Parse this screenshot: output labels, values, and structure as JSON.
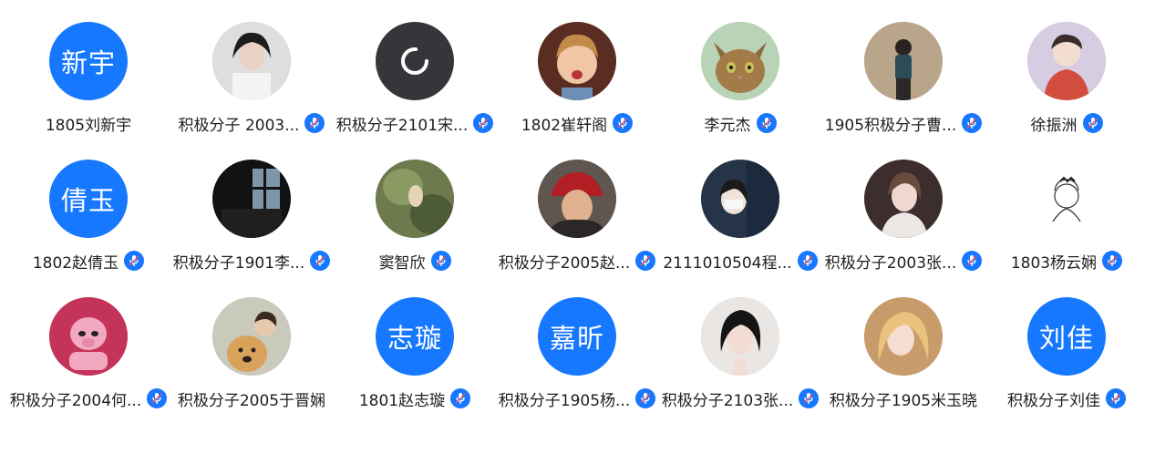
{
  "colors": {
    "accent": "#1677ff",
    "text": "#1e1e1e",
    "background": "#ffffff"
  },
  "mic_icon": "microphone-icon",
  "members": [
    {
      "name": "1805刘新宇",
      "avatar_text": "新宇",
      "avatar_type": "text",
      "mic": false
    },
    {
      "name": "积极分子 2003...",
      "avatar_type": "photo",
      "photo_desc_icon": "person-photo",
      "mic": true
    },
    {
      "name": "积极分子2101宋...",
      "avatar_type": "loading",
      "mic": true
    },
    {
      "name": "1802崔轩阁",
      "avatar_type": "photo",
      "photo_desc_icon": "child-photo",
      "mic": true
    },
    {
      "name": "李元杰",
      "avatar_type": "photo",
      "photo_desc_icon": "cat-photo",
      "mic": true
    },
    {
      "name": "1905积极分子曹...",
      "avatar_type": "photo",
      "photo_desc_icon": "person-photo",
      "mic": true
    },
    {
      "name": "徐振洲",
      "avatar_type": "photo",
      "photo_desc_icon": "illustration-photo",
      "mic": true
    },
    {
      "name": "1802赵倩玉",
      "avatar_text": "倩玉",
      "avatar_type": "text",
      "mic": true
    },
    {
      "name": "积极分子1901李...",
      "avatar_type": "photo",
      "photo_desc_icon": "window-photo",
      "mic": true
    },
    {
      "name": "窦智欣",
      "avatar_type": "photo",
      "photo_desc_icon": "person-photo",
      "mic": true
    },
    {
      "name": "积极分子2005赵...",
      "avatar_type": "photo",
      "photo_desc_icon": "person-hat-photo",
      "mic": true
    },
    {
      "name": "2111010504程...",
      "avatar_type": "photo",
      "photo_desc_icon": "person-photo",
      "mic": true
    },
    {
      "name": "积极分子2003张...",
      "avatar_type": "photo",
      "photo_desc_icon": "person-photo",
      "mic": true
    },
    {
      "name": "1803杨云娴",
      "avatar_type": "photo",
      "photo_desc_icon": "sketch-photo",
      "mic": true
    },
    {
      "name": "积极分子2004何...",
      "avatar_type": "photo",
      "photo_desc_icon": "piglet-photo",
      "mic": true
    },
    {
      "name": "积极分子2005于晋娴",
      "avatar_type": "photo",
      "photo_desc_icon": "dog-photo",
      "mic": false
    },
    {
      "name": "1801赵志璇",
      "avatar_text": "志璇",
      "avatar_type": "text",
      "mic": true
    },
    {
      "name": "积极分子1905杨...",
      "avatar_text": "嘉昕",
      "avatar_type": "text",
      "mic": true
    },
    {
      "name": "积极分子2103张...",
      "avatar_type": "photo",
      "photo_desc_icon": "person-photo",
      "mic": true
    },
    {
      "name": "积极分子1905米玉晓",
      "avatar_type": "photo",
      "photo_desc_icon": "person-photo",
      "mic": false
    },
    {
      "name": "积极分子刘佳",
      "avatar_text": "刘佳",
      "avatar_type": "text",
      "mic": true
    }
  ]
}
